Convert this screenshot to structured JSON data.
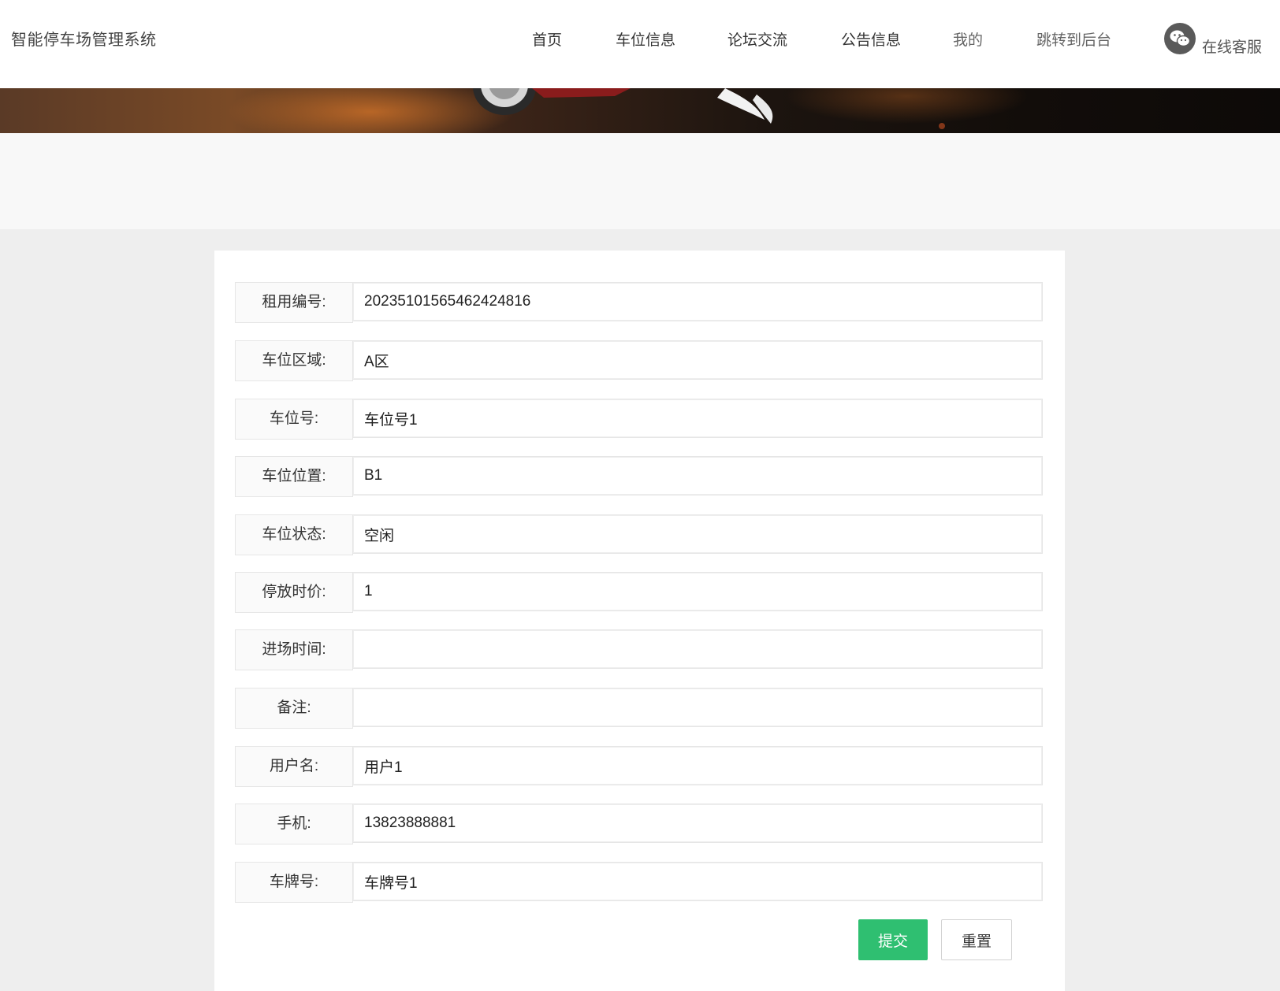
{
  "header": {
    "site_title": "智能停车场管理系统",
    "nav": [
      {
        "label": "首页"
      },
      {
        "label": "车位信息"
      },
      {
        "label": "论坛交流"
      },
      {
        "label": "公告信息"
      },
      {
        "label": "我的"
      },
      {
        "label": "跳转到后台"
      }
    ],
    "service_label": "在线客服",
    "service_icon": "wechat-icon"
  },
  "form": {
    "fields": [
      {
        "label": "租用编号:",
        "value": "20235101565462424816"
      },
      {
        "label": "车位区域:",
        "value": "A区"
      },
      {
        "label": "车位号:",
        "value": "车位号1"
      },
      {
        "label": "车位位置:",
        "value": "B1"
      },
      {
        "label": "车位状态:",
        "value": "空闲"
      },
      {
        "label": "停放时价:",
        "value": "1"
      },
      {
        "label": "进场时间:",
        "value": ""
      },
      {
        "label": "备注:",
        "value": ""
      },
      {
        "label": "用户名:",
        "value": "用户1"
      },
      {
        "label": "手机:",
        "value": "13823888881"
      },
      {
        "label": "车牌号:",
        "value": "车牌号1"
      }
    ],
    "submit_label": "提交",
    "reset_label": "重置"
  },
  "colors": {
    "accent": "#2fbf71",
    "header_bg": "#ffffff",
    "page_bg": "#eeeeee"
  }
}
